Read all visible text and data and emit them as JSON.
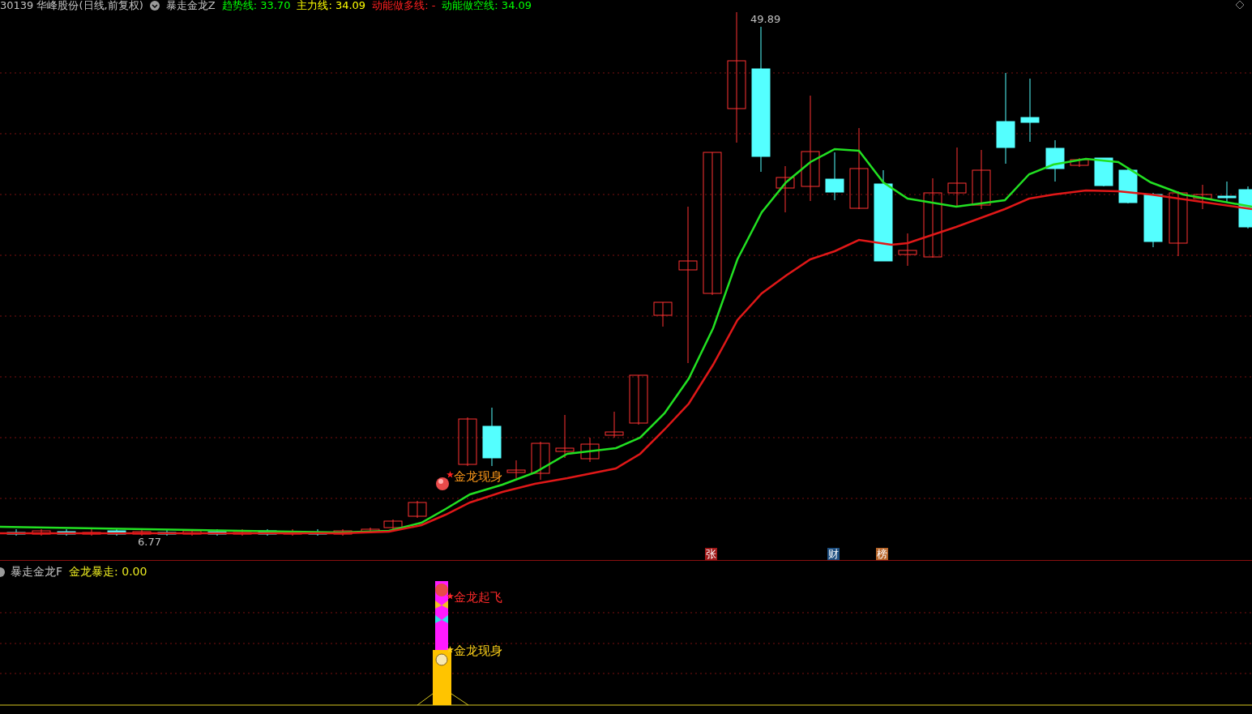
{
  "header": {
    "stock": "30139 华峰股份(日线,前复权)",
    "indicator": "暴走金龙Z",
    "values": [
      {
        "text": "趋势线: 33.70",
        "color": "#00ff00"
      },
      {
        "text": "主力线: 34.09",
        "color": "#ffff00"
      },
      {
        "text": "动能做多线: -",
        "color": "#ff2020"
      },
      {
        "text": "动能做空线: 34.09",
        "color": "#00ff00"
      }
    ]
  },
  "price_chart": {
    "high_label": "49.89",
    "low_label": "6.77",
    "signal": "金龙现身",
    "badges": [
      {
        "text": "张",
        "color": "#a01818"
      },
      {
        "text": "财",
        "color": "#1c4e80"
      },
      {
        "text": "榜",
        "color": "#b8662a"
      }
    ]
  },
  "lower_pane": {
    "indicator": "暴走金龙F",
    "value": "金龙暴走: 0.00",
    "signals": [
      {
        "text": "金龙起飞",
        "kind": "fly"
      },
      {
        "text": "金龙现身",
        "kind": "appear"
      }
    ]
  }
}
